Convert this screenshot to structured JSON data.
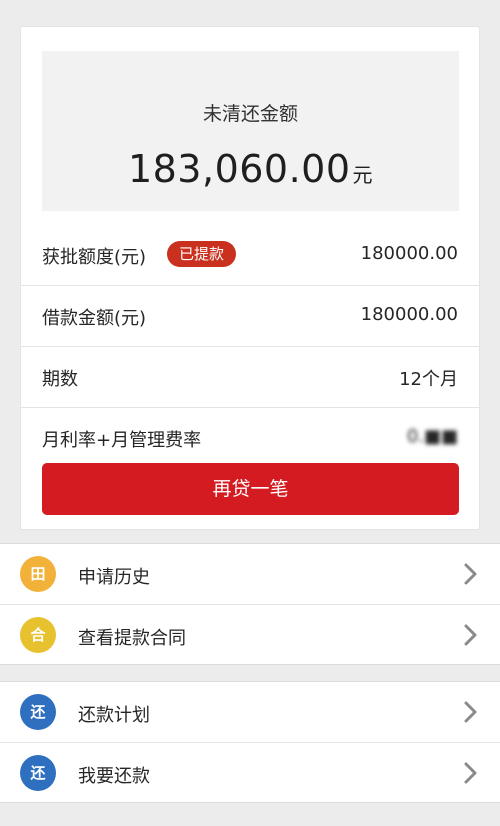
{
  "summary": {
    "label": "未清还金额",
    "amount": "183,060.00",
    "unit": "元"
  },
  "details": [
    {
      "label": "获批额度(元)",
      "badge": "已提款",
      "value": "180000.00"
    },
    {
      "label": "借款金额(元)",
      "value": "180000.00"
    },
    {
      "label": "期数",
      "value": "12个月"
    },
    {
      "label": "月利率+月管理费率",
      "value": "0.■■"
    }
  ],
  "primary_button": {
    "label": "再贷一笔"
  },
  "menu_group_1": [
    {
      "label": "申请历史",
      "icon": "grid-icon",
      "glyph": "田",
      "color": "#f2b23a"
    },
    {
      "label": "查看提款合同",
      "icon": "contract-icon",
      "glyph": "合",
      "color": "#e8c22e"
    }
  ],
  "menu_group_2": [
    {
      "label": "还款计划",
      "icon": "repay-icon",
      "glyph": "还",
      "color": "#2f6fbf"
    },
    {
      "label": "我要还款",
      "icon": "repay-icon",
      "glyph": "还",
      "color": "#2f6fbf"
    }
  ],
  "colors": {
    "primary": "#d41b21",
    "badge": "#c9301d",
    "background": "#ececec"
  }
}
